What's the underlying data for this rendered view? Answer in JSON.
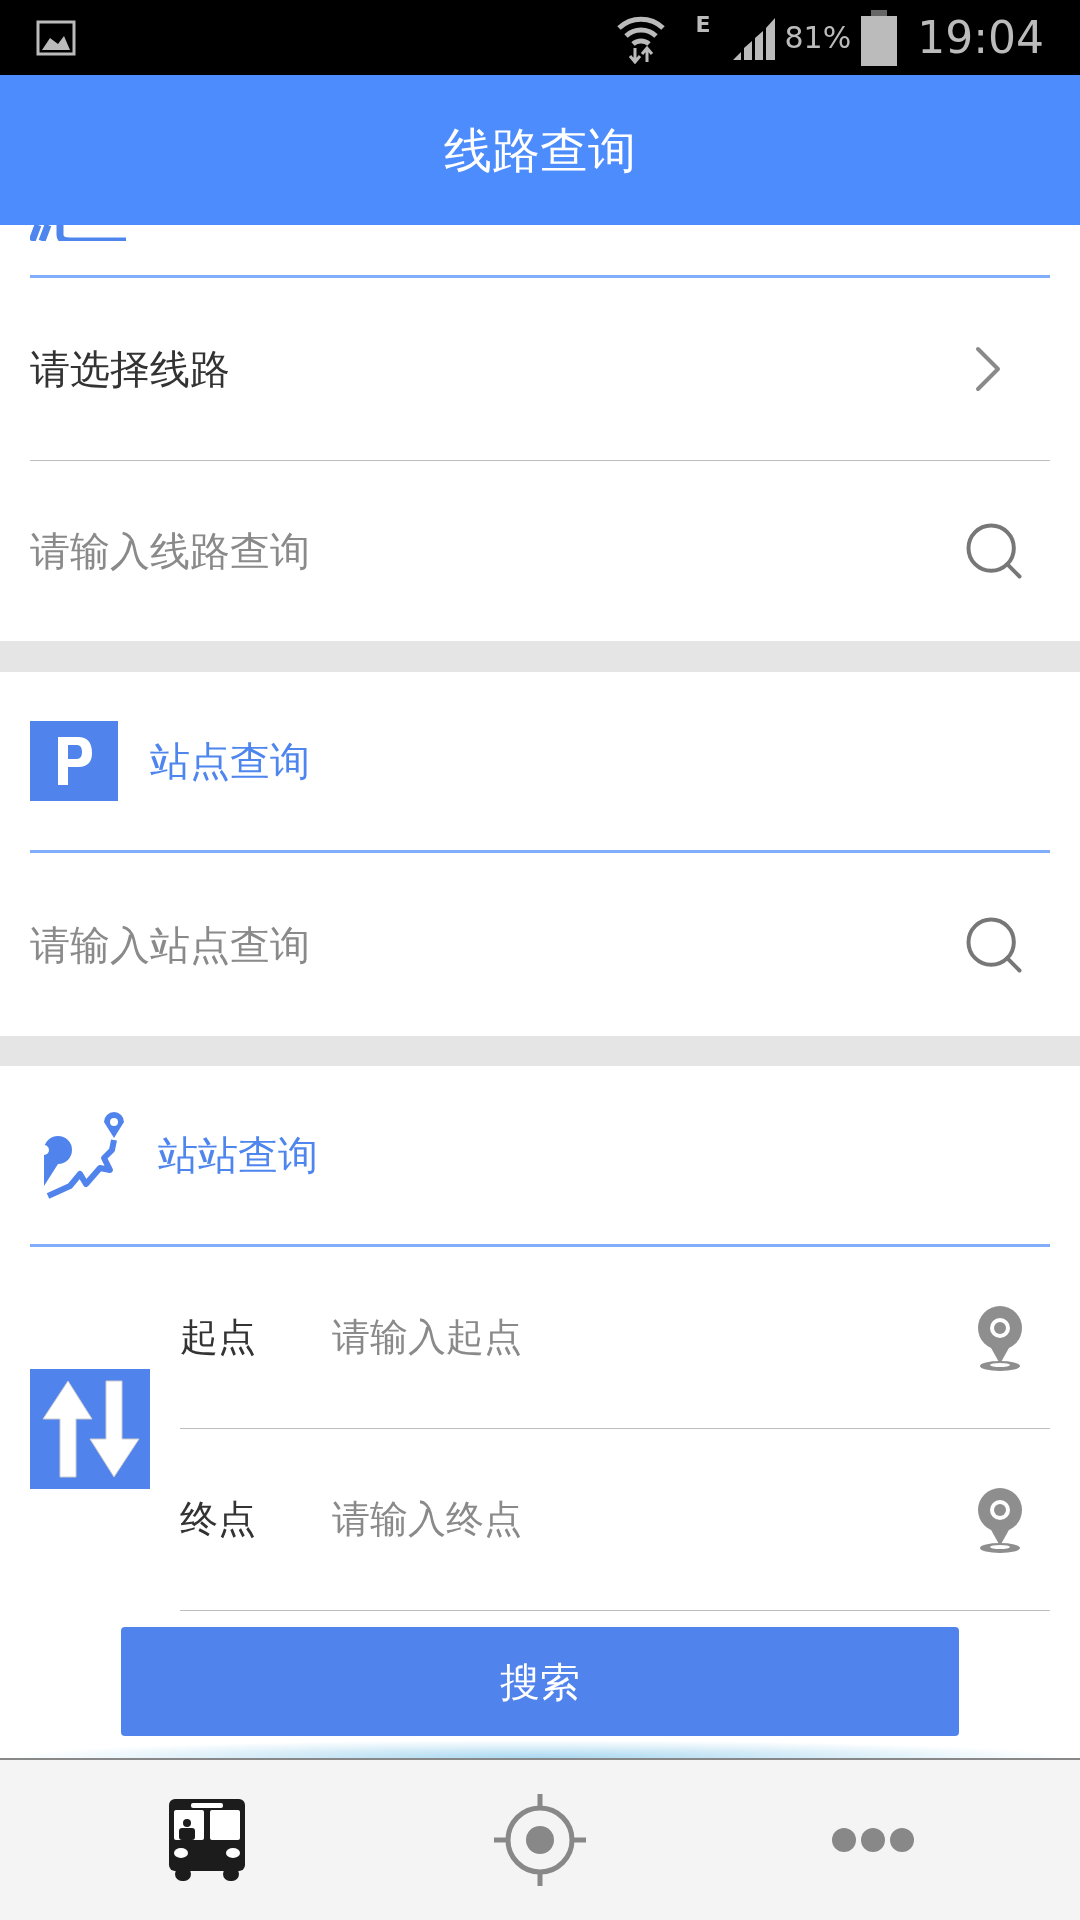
{
  "status_bar": {
    "network": "E",
    "battery": "81%",
    "time": "19:04"
  },
  "header": {
    "title": "线路查询"
  },
  "line_section": {
    "select": {
      "label": "请选择线路"
    },
    "search": {
      "placeholder": "请输入线路查询"
    }
  },
  "stop_section": {
    "title": "站点查询",
    "search": {
      "placeholder": "请输入站点查询"
    }
  },
  "route_section": {
    "title": "站站查询",
    "fields": [
      {
        "label": "起点",
        "placeholder": "请输入起点"
      },
      {
        "label": "终点",
        "placeholder": "请输入终点"
      }
    ],
    "button": "搜索"
  },
  "bottom_nav": [
    {
      "kind": "bus",
      "selected": true
    },
    {
      "kind": "locate",
      "selected": false
    },
    {
      "kind": "more",
      "selected": false
    }
  ]
}
